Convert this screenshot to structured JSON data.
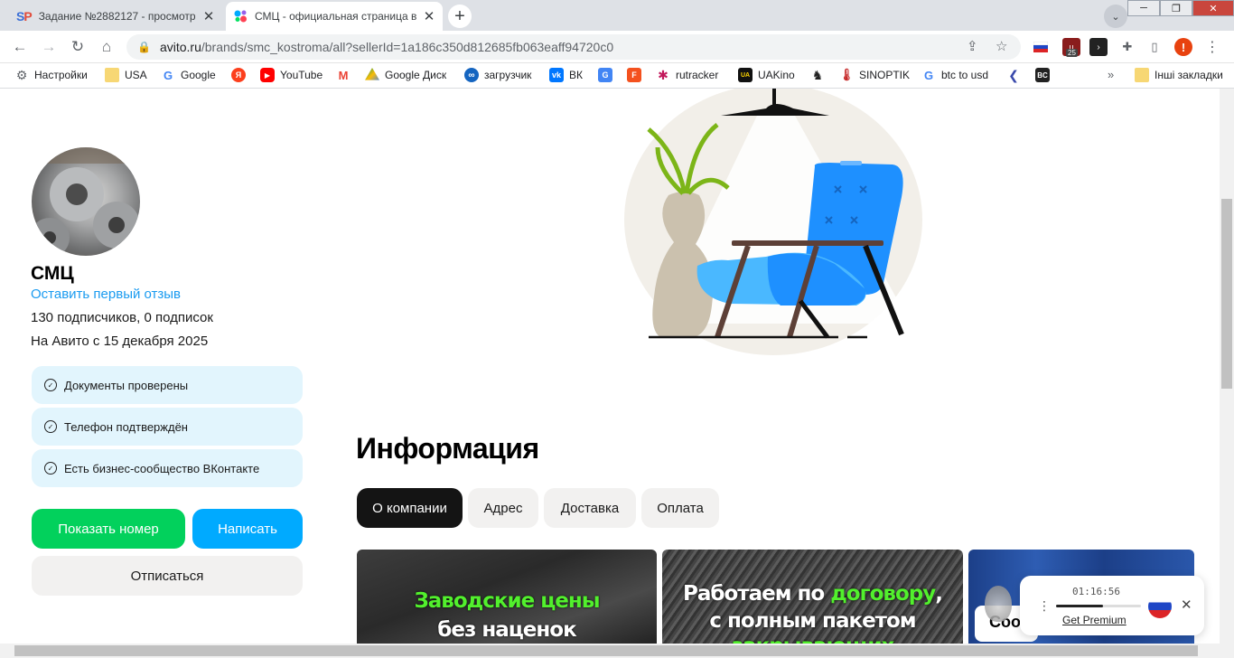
{
  "browser": {
    "tabs": [
      {
        "title": "Задание №2882127 - просмотр",
        "favicon": "sp-logo"
      },
      {
        "title": "СМЦ - официальная страница в",
        "favicon": "avito-logo"
      }
    ],
    "address": {
      "host": "avito.ru",
      "path": "/brands/smc_kostroma/all?sellerId=1a186c350d812685fb063eaff94720c0"
    },
    "extension_badge": "25",
    "profile_initial": "!",
    "bookmarks": [
      {
        "label": "Настройки",
        "icon": "gear-icon"
      },
      {
        "label": "USA",
        "icon": "folder-icon"
      },
      {
        "label": "Google",
        "icon": "google-icon"
      },
      {
        "label": "",
        "icon": "yandex-icon"
      },
      {
        "label": "YouTube",
        "icon": "youtube-icon"
      },
      {
        "label": "",
        "icon": "gmail-icon"
      },
      {
        "label": "Google Диск",
        "icon": "drive-icon"
      },
      {
        "label": "загрузчик",
        "icon": "infinity-icon"
      },
      {
        "label": "ВК",
        "icon": "vk-icon"
      },
      {
        "label": "",
        "icon": "translate-icon"
      },
      {
        "label": "",
        "icon": "f-icon"
      },
      {
        "label": "rutracker",
        "icon": "rutracker-icon"
      },
      {
        "label": "UAKino",
        "icon": "uakino-icon"
      },
      {
        "label": "",
        "icon": "chess-icon"
      },
      {
        "label": "SINOPTIK",
        "icon": "thermometer-icon"
      },
      {
        "label": "btc to usd",
        "icon": "google-icon"
      },
      {
        "label": "",
        "icon": "arrow-icon"
      },
      {
        "label": "",
        "icon": "bc-icon"
      }
    ],
    "other_bookmarks": "Інші закладки"
  },
  "seller": {
    "name": "СМЦ",
    "review_link": "Оставить первый отзыв",
    "subscribers": "130 подписчиков, 0 подписок",
    "since": "На Авито с 15 декабря 2025",
    "badges": [
      "Документы проверены",
      "Телефон подтверждён",
      "Есть бизнес-сообщество ВКонтакте"
    ],
    "buttons": {
      "show_number": "Показать номер",
      "write": "Написать",
      "unsubscribe": "Отписаться"
    }
  },
  "info": {
    "title": "Информация",
    "tabs": [
      "О компании",
      "Адрес",
      "Доставка",
      "Оплата"
    ],
    "active_tab": 0,
    "cards": [
      {
        "line1": "Заводские цены",
        "line2": "без наценок"
      },
      {
        "line1_a": "Работаем по ",
        "line1_b": "договору",
        "line1_c": ",",
        "line2": "с полным пакетом",
        "line3": "закрывающих документов"
      }
    ],
    "message_button": "Соо"
  },
  "timer_widget": {
    "time": "01:16:56",
    "link": "Get Premium",
    "progress": 0.55
  },
  "colors": {
    "accent_blue": "#00aaff",
    "accent_green": "#02d15c",
    "link": "#1a9bf0"
  }
}
